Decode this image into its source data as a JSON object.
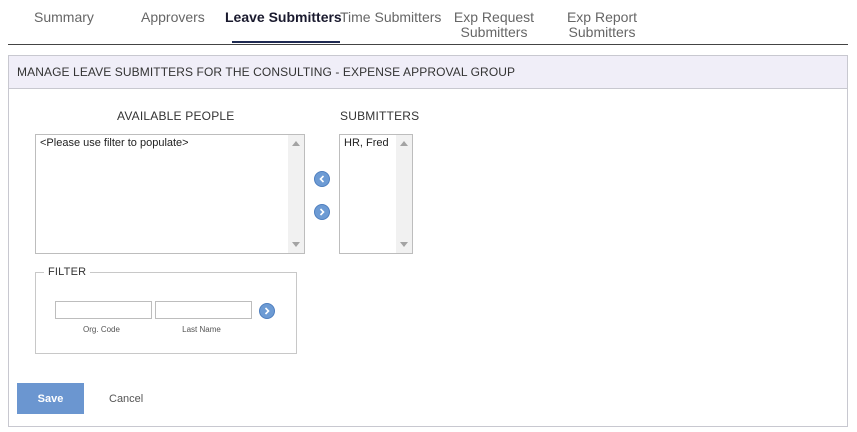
{
  "tabs": [
    {
      "label": "Summary"
    },
    {
      "label": "Approvers"
    },
    {
      "label": "Leave Submitters"
    },
    {
      "label": "Time Submitters"
    },
    {
      "label": "Exp Request Submitters"
    },
    {
      "label": "Exp Report Submitters"
    }
  ],
  "active_tab": "Leave Submitters",
  "panel": {
    "title": "MANAGE LEAVE SUBMITTERS FOR THE CONSULTING - EXPENSE APPROVAL GROUP"
  },
  "available": {
    "heading": "AVAILABLE PEOPLE",
    "placeholder_item": "<Please use filter to populate>"
  },
  "submitters": {
    "heading": "SUBMITTERS",
    "items": [
      "HR, Fred"
    ]
  },
  "filter": {
    "legend": "FILTER",
    "org_code_label": "Org. Code",
    "last_name_label": "Last Name",
    "org_code_value": "",
    "last_name_value": ""
  },
  "actions": {
    "save_label": "Save",
    "cancel_label": "Cancel"
  },
  "colors": {
    "accent": "#6b96d0",
    "header_bg": "#f0eef8",
    "active_tab_underline": "#1e2a52"
  },
  "icons": {
    "move_left": "chevron-left-icon",
    "move_right": "chevron-right-icon",
    "filter_go": "chevron-right-icon"
  }
}
